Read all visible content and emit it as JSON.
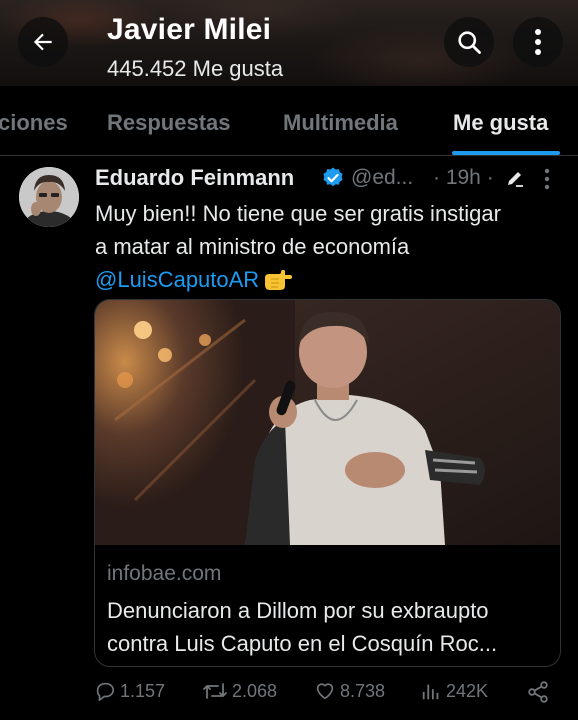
{
  "header": {
    "title": "Javier Milei",
    "subtitle": "445.452 Me gusta",
    "back_icon": "arrow-left-icon",
    "search_icon": "search-icon",
    "more_icon": "more-vertical-icon"
  },
  "tabs": [
    {
      "label": "ciones",
      "active": false
    },
    {
      "label": "Respuestas",
      "active": false
    },
    {
      "label": "Multimedia",
      "active": false
    },
    {
      "label": "Me gusta",
      "active": true
    }
  ],
  "tweet": {
    "author_name": "Eduardo Feinmann",
    "verified": true,
    "handle": "@ed...",
    "time": "· 19h ·",
    "text_lines": [
      "Muy bien!! No tiene que ser gratis instigar",
      "a matar al ministro de economía"
    ],
    "mention": "@LuisCaputoAR",
    "emoji": "👉",
    "card": {
      "domain": "infobae.com",
      "title_lines": [
        "Denunciaron a Dillom por su exbraupto",
        "contra Luis Caputo en el Cosquín Roc..."
      ]
    },
    "stats": {
      "replies": "1.157",
      "retweets": "2.068",
      "likes": "8.738",
      "views": "242K"
    }
  },
  "colors": {
    "background": "#000000",
    "text": "#e7e9ea",
    "muted": "#71767b",
    "accent": "#1d9bf0",
    "divider": "#2f3336"
  }
}
